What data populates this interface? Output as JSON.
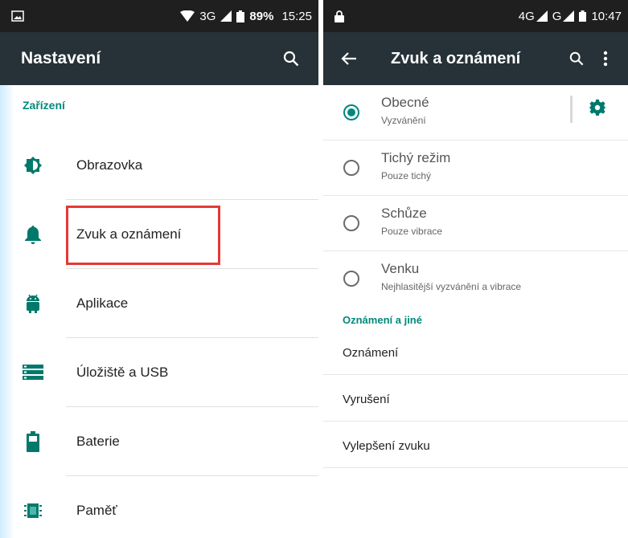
{
  "left": {
    "status": {
      "network": "3G",
      "battery": "89%",
      "time": "15:25"
    },
    "title": "Nastavení",
    "section": "Zařízení",
    "items": [
      {
        "label": "Obrazovka",
        "icon": "brightness-icon"
      },
      {
        "label": "Zvuk a oznámení",
        "icon": "bell-icon"
      },
      {
        "label": "Aplikace",
        "icon": "android-icon"
      },
      {
        "label": "Úložiště a USB",
        "icon": "storage-icon"
      },
      {
        "label": "Baterie",
        "icon": "battery-icon"
      },
      {
        "label": "Paměť",
        "icon": "memory-icon"
      }
    ]
  },
  "right": {
    "status": {
      "network1": "4G",
      "network2": "G",
      "time": "10:47"
    },
    "title": "Zvuk a oznámení",
    "profiles": [
      {
        "title": "Obecné",
        "subtitle": "Vyzvánění",
        "selected": true
      },
      {
        "title": "Tichý režim",
        "subtitle": "Pouze tichý",
        "selected": false
      },
      {
        "title": "Schůze",
        "subtitle": "Pouze vibrace",
        "selected": false
      },
      {
        "title": "Venku",
        "subtitle": "Nejhlasitější vyzvánění a vibrace",
        "selected": false
      }
    ],
    "section": "Oznámení a jiné",
    "items": [
      "Oznámení",
      "Vyrušení",
      "Vylepšení zvuku"
    ]
  },
  "colors": {
    "accent": "#00897b",
    "appbar": "#263238",
    "statusbar": "#1f1f1f",
    "highlight": "#e53935"
  }
}
